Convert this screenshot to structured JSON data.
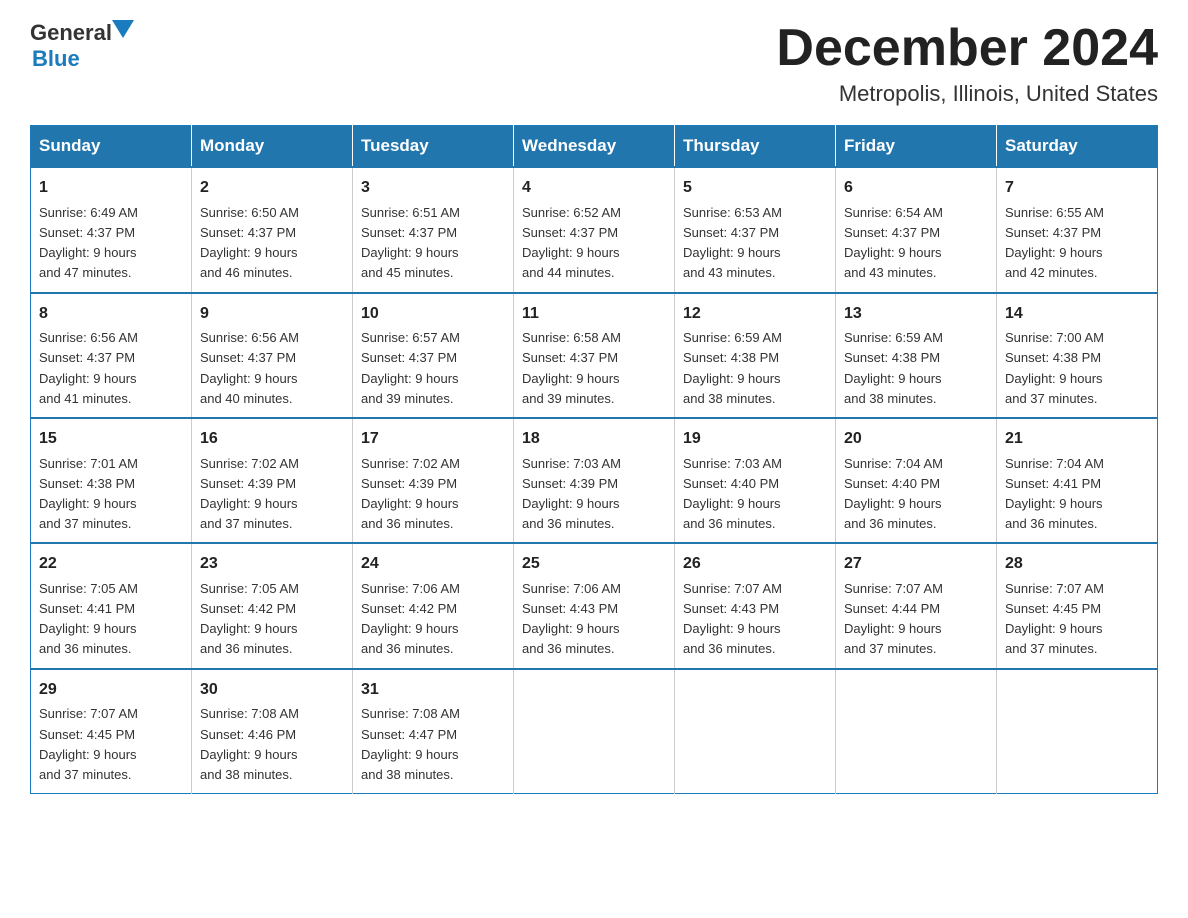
{
  "header": {
    "logo": {
      "general": "General",
      "blue": "Blue"
    },
    "month_title": "December 2024",
    "location": "Metropolis, Illinois, United States"
  },
  "days_of_week": [
    "Sunday",
    "Monday",
    "Tuesday",
    "Wednesday",
    "Thursday",
    "Friday",
    "Saturday"
  ],
  "weeks": [
    [
      {
        "day": "1",
        "sunrise": "Sunrise: 6:49 AM",
        "sunset": "Sunset: 4:37 PM",
        "daylight": "Daylight: 9 hours",
        "daylight2": "and 47 minutes."
      },
      {
        "day": "2",
        "sunrise": "Sunrise: 6:50 AM",
        "sunset": "Sunset: 4:37 PM",
        "daylight": "Daylight: 9 hours",
        "daylight2": "and 46 minutes."
      },
      {
        "day": "3",
        "sunrise": "Sunrise: 6:51 AM",
        "sunset": "Sunset: 4:37 PM",
        "daylight": "Daylight: 9 hours",
        "daylight2": "and 45 minutes."
      },
      {
        "day": "4",
        "sunrise": "Sunrise: 6:52 AM",
        "sunset": "Sunset: 4:37 PM",
        "daylight": "Daylight: 9 hours",
        "daylight2": "and 44 minutes."
      },
      {
        "day": "5",
        "sunrise": "Sunrise: 6:53 AM",
        "sunset": "Sunset: 4:37 PM",
        "daylight": "Daylight: 9 hours",
        "daylight2": "and 43 minutes."
      },
      {
        "day": "6",
        "sunrise": "Sunrise: 6:54 AM",
        "sunset": "Sunset: 4:37 PM",
        "daylight": "Daylight: 9 hours",
        "daylight2": "and 43 minutes."
      },
      {
        "day": "7",
        "sunrise": "Sunrise: 6:55 AM",
        "sunset": "Sunset: 4:37 PM",
        "daylight": "Daylight: 9 hours",
        "daylight2": "and 42 minutes."
      }
    ],
    [
      {
        "day": "8",
        "sunrise": "Sunrise: 6:56 AM",
        "sunset": "Sunset: 4:37 PM",
        "daylight": "Daylight: 9 hours",
        "daylight2": "and 41 minutes."
      },
      {
        "day": "9",
        "sunrise": "Sunrise: 6:56 AM",
        "sunset": "Sunset: 4:37 PM",
        "daylight": "Daylight: 9 hours",
        "daylight2": "and 40 minutes."
      },
      {
        "day": "10",
        "sunrise": "Sunrise: 6:57 AM",
        "sunset": "Sunset: 4:37 PM",
        "daylight": "Daylight: 9 hours",
        "daylight2": "and 39 minutes."
      },
      {
        "day": "11",
        "sunrise": "Sunrise: 6:58 AM",
        "sunset": "Sunset: 4:37 PM",
        "daylight": "Daylight: 9 hours",
        "daylight2": "and 39 minutes."
      },
      {
        "day": "12",
        "sunrise": "Sunrise: 6:59 AM",
        "sunset": "Sunset: 4:38 PM",
        "daylight": "Daylight: 9 hours",
        "daylight2": "and 38 minutes."
      },
      {
        "day": "13",
        "sunrise": "Sunrise: 6:59 AM",
        "sunset": "Sunset: 4:38 PM",
        "daylight": "Daylight: 9 hours",
        "daylight2": "and 38 minutes."
      },
      {
        "day": "14",
        "sunrise": "Sunrise: 7:00 AM",
        "sunset": "Sunset: 4:38 PM",
        "daylight": "Daylight: 9 hours",
        "daylight2": "and 37 minutes."
      }
    ],
    [
      {
        "day": "15",
        "sunrise": "Sunrise: 7:01 AM",
        "sunset": "Sunset: 4:38 PM",
        "daylight": "Daylight: 9 hours",
        "daylight2": "and 37 minutes."
      },
      {
        "day": "16",
        "sunrise": "Sunrise: 7:02 AM",
        "sunset": "Sunset: 4:39 PM",
        "daylight": "Daylight: 9 hours",
        "daylight2": "and 37 minutes."
      },
      {
        "day": "17",
        "sunrise": "Sunrise: 7:02 AM",
        "sunset": "Sunset: 4:39 PM",
        "daylight": "Daylight: 9 hours",
        "daylight2": "and 36 minutes."
      },
      {
        "day": "18",
        "sunrise": "Sunrise: 7:03 AM",
        "sunset": "Sunset: 4:39 PM",
        "daylight": "Daylight: 9 hours",
        "daylight2": "and 36 minutes."
      },
      {
        "day": "19",
        "sunrise": "Sunrise: 7:03 AM",
        "sunset": "Sunset: 4:40 PM",
        "daylight": "Daylight: 9 hours",
        "daylight2": "and 36 minutes."
      },
      {
        "day": "20",
        "sunrise": "Sunrise: 7:04 AM",
        "sunset": "Sunset: 4:40 PM",
        "daylight": "Daylight: 9 hours",
        "daylight2": "and 36 minutes."
      },
      {
        "day": "21",
        "sunrise": "Sunrise: 7:04 AM",
        "sunset": "Sunset: 4:41 PM",
        "daylight": "Daylight: 9 hours",
        "daylight2": "and 36 minutes."
      }
    ],
    [
      {
        "day": "22",
        "sunrise": "Sunrise: 7:05 AM",
        "sunset": "Sunset: 4:41 PM",
        "daylight": "Daylight: 9 hours",
        "daylight2": "and 36 minutes."
      },
      {
        "day": "23",
        "sunrise": "Sunrise: 7:05 AM",
        "sunset": "Sunset: 4:42 PM",
        "daylight": "Daylight: 9 hours",
        "daylight2": "and 36 minutes."
      },
      {
        "day": "24",
        "sunrise": "Sunrise: 7:06 AM",
        "sunset": "Sunset: 4:42 PM",
        "daylight": "Daylight: 9 hours",
        "daylight2": "and 36 minutes."
      },
      {
        "day": "25",
        "sunrise": "Sunrise: 7:06 AM",
        "sunset": "Sunset: 4:43 PM",
        "daylight": "Daylight: 9 hours",
        "daylight2": "and 36 minutes."
      },
      {
        "day": "26",
        "sunrise": "Sunrise: 7:07 AM",
        "sunset": "Sunset: 4:43 PM",
        "daylight": "Daylight: 9 hours",
        "daylight2": "and 36 minutes."
      },
      {
        "day": "27",
        "sunrise": "Sunrise: 7:07 AM",
        "sunset": "Sunset: 4:44 PM",
        "daylight": "Daylight: 9 hours",
        "daylight2": "and 37 minutes."
      },
      {
        "day": "28",
        "sunrise": "Sunrise: 7:07 AM",
        "sunset": "Sunset: 4:45 PM",
        "daylight": "Daylight: 9 hours",
        "daylight2": "and 37 minutes."
      }
    ],
    [
      {
        "day": "29",
        "sunrise": "Sunrise: 7:07 AM",
        "sunset": "Sunset: 4:45 PM",
        "daylight": "Daylight: 9 hours",
        "daylight2": "and 37 minutes."
      },
      {
        "day": "30",
        "sunrise": "Sunrise: 7:08 AM",
        "sunset": "Sunset: 4:46 PM",
        "daylight": "Daylight: 9 hours",
        "daylight2": "and 38 minutes."
      },
      {
        "day": "31",
        "sunrise": "Sunrise: 7:08 AM",
        "sunset": "Sunset: 4:47 PM",
        "daylight": "Daylight: 9 hours",
        "daylight2": "and 38 minutes."
      },
      null,
      null,
      null,
      null
    ]
  ]
}
